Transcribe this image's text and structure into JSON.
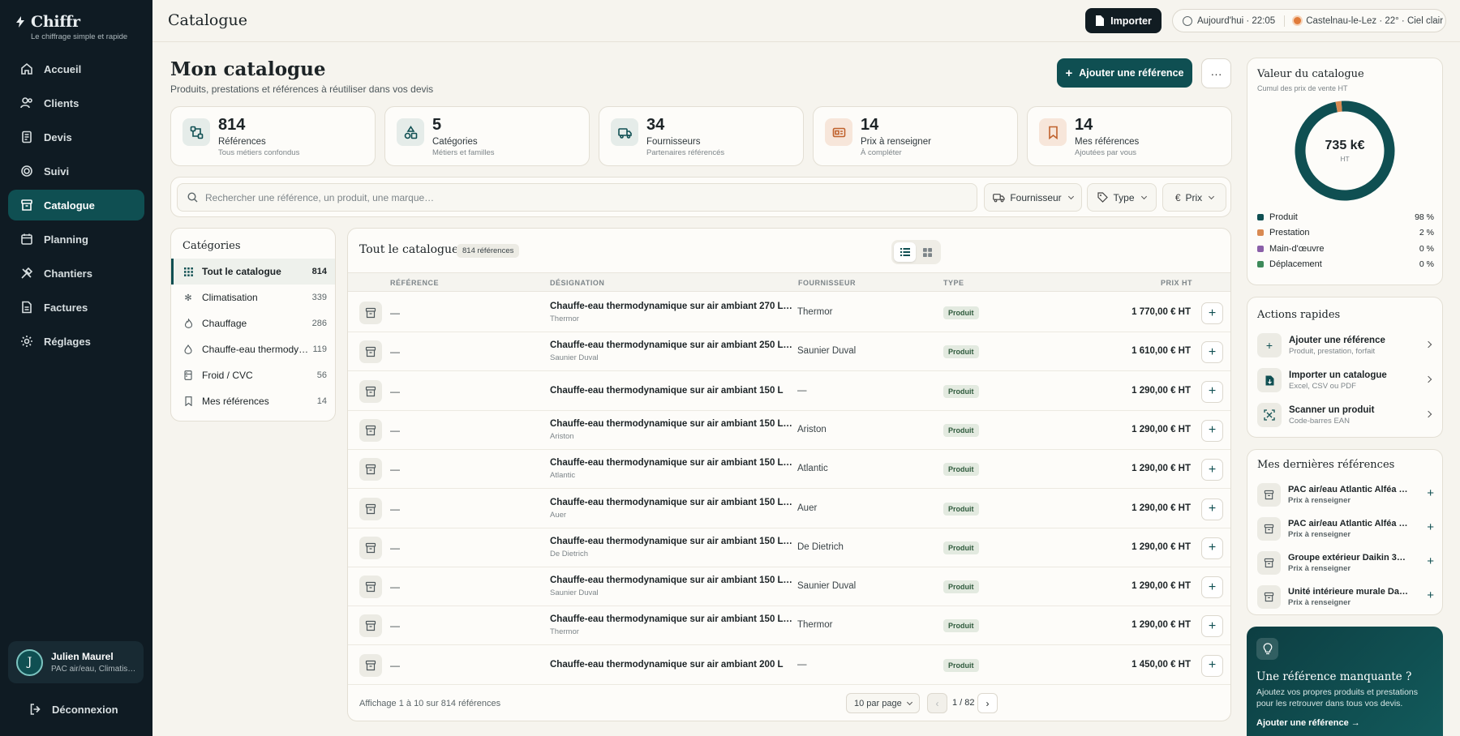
{
  "app": {
    "name": "Chiffr",
    "tagline": "Le chiffrage simple et rapide"
  },
  "nav": [
    {
      "label": "Accueil",
      "icon": "home-icon"
    },
    {
      "label": "Clients",
      "icon": "users-icon"
    },
    {
      "label": "Devis",
      "icon": "document-icon"
    },
    {
      "label": "Suivi",
      "icon": "target-icon"
    },
    {
      "label": "Catalogue",
      "icon": "archive-icon",
      "active": true
    },
    {
      "label": "Planning",
      "icon": "calendar-icon"
    },
    {
      "label": "Chantiers",
      "icon": "tools-icon"
    },
    {
      "label": "Factures",
      "icon": "invoice-icon"
    },
    {
      "label": "Réglages",
      "icon": "gear-icon"
    }
  ],
  "user": {
    "initial": "J",
    "name": "Julien Maurel",
    "sub": "PAC air/eau, Climatis…"
  },
  "logout_label": "Déconnexion",
  "topbar": {
    "title": "Catalogue",
    "import_label": "Importer",
    "time": "Aujourd'hui · 22:05",
    "weather": "Castelnau-le-Lez · 22° · Ciel clair"
  },
  "page": {
    "title": "Mon catalogue",
    "subtitle": "Produits, prestations et références à réutiliser dans vos devis",
    "add_label": "Ajouter une référence",
    "more_label": "···"
  },
  "stats": [
    {
      "value": "814",
      "label": "Références",
      "sub": "Tous métiers confondus",
      "color": "#0f4f52",
      "bg": "#e5ece9",
      "icon": "network-icon"
    },
    {
      "value": "5",
      "label": "Catégories",
      "sub": "Métiers et familles",
      "color": "#0f4f52",
      "bg": "#e5ece9",
      "icon": "shapes-icon"
    },
    {
      "value": "34",
      "label": "Fournisseurs",
      "sub": "Partenaires référencés",
      "color": "#0f4f52",
      "bg": "#e5ece9",
      "icon": "truck-icon"
    },
    {
      "value": "14",
      "label": "Prix à renseigner",
      "sub": "À compléter",
      "color": "#c0622d",
      "bg": "#f7e6da",
      "icon": "price-tag-icon"
    },
    {
      "value": "14",
      "label": "Mes références",
      "sub": "Ajoutées par vous",
      "color": "#c0622d",
      "bg": "#f7e6da",
      "icon": "bookmark-icon"
    }
  ],
  "search": {
    "placeholder": "Rechercher une référence, un produit, une marque…",
    "filters": [
      "Fournisseur",
      "Type",
      "Prix"
    ]
  },
  "categories": {
    "title": "Catégories",
    "items": [
      {
        "label": "Tout le catalogue",
        "count": "814",
        "icon": "grid-icon",
        "active": true
      },
      {
        "label": "Climatisation",
        "count": "339",
        "icon": "snowflake-icon"
      },
      {
        "label": "Chauffage",
        "count": "286",
        "icon": "flame-icon"
      },
      {
        "label": "Chauffe-eau thermody…",
        "count": "119",
        "icon": "droplet-icon"
      },
      {
        "label": "Froid / CVC",
        "count": "56",
        "icon": "fridge-icon"
      },
      {
        "label": "Mes références",
        "count": "14",
        "icon": "bookmark-icon"
      }
    ]
  },
  "table": {
    "title": "Tout le catalogue",
    "badge": "814 références",
    "columns": {
      "ref": "RÉFÉRENCE",
      "name": "DÉSIGNATION",
      "supplier": "FOURNISSEUR",
      "type": "TYPE",
      "price": "PRIX HT"
    },
    "rows": [
      {
        "ref": "—",
        "name": "Chauffe-eau thermodynamique sur air ambiant 270 L T…",
        "sub": "Thermor",
        "supplier": "Thermor",
        "type": "Produit",
        "price": "1 770,00 € HT"
      },
      {
        "ref": "—",
        "name": "Chauffe-eau thermodynamique sur air ambiant 250 L S…",
        "sub": "Saunier Duval",
        "supplier": "Saunier Duval",
        "type": "Produit",
        "price": "1 610,00 € HT"
      },
      {
        "ref": "—",
        "name": "Chauffe-eau thermodynamique sur air ambiant 150 L",
        "sub": "",
        "supplier": "—",
        "type": "Produit",
        "price": "1 290,00 € HT"
      },
      {
        "ref": "—",
        "name": "Chauffe-eau thermodynamique sur air ambiant 150 L A…",
        "sub": "Ariston",
        "supplier": "Ariston",
        "type": "Produit",
        "price": "1 290,00 € HT"
      },
      {
        "ref": "—",
        "name": "Chauffe-eau thermodynamique sur air ambiant 150 L A…",
        "sub": "Atlantic",
        "supplier": "Atlantic",
        "type": "Produit",
        "price": "1 290,00 € HT"
      },
      {
        "ref": "—",
        "name": "Chauffe-eau thermodynamique sur air ambiant 150 L A…",
        "sub": "Auer",
        "supplier": "Auer",
        "type": "Produit",
        "price": "1 290,00 € HT"
      },
      {
        "ref": "—",
        "name": "Chauffe-eau thermodynamique sur air ambiant 150 L D…",
        "sub": "De Dietrich",
        "supplier": "De Dietrich",
        "type": "Produit",
        "price": "1 290,00 € HT"
      },
      {
        "ref": "—",
        "name": "Chauffe-eau thermodynamique sur air ambiant 150 L S…",
        "sub": "Saunier Duval",
        "supplier": "Saunier Duval",
        "type": "Produit",
        "price": "1 290,00 € HT"
      },
      {
        "ref": "—",
        "name": "Chauffe-eau thermodynamique sur air ambiant 150 L T…",
        "sub": "Thermor",
        "supplier": "Thermor",
        "type": "Produit",
        "price": "1 290,00 € HT"
      },
      {
        "ref": "—",
        "name": "Chauffe-eau thermodynamique sur air ambiant 200 L",
        "sub": "",
        "supplier": "—",
        "type": "Produit",
        "price": "1 450,00 € HT"
      }
    ],
    "footer": "Affichage 1 à 10 sur 814 références",
    "per_page": "10 par page",
    "page": "1 / 82"
  },
  "value_card": {
    "title": "Valeur du catalogue",
    "sub": "Cumul des prix de vente HT",
    "total": "735 k€",
    "unit": "HT",
    "segments": [
      {
        "label": "Produit",
        "pct": "98 %",
        "value": 98,
        "color": "#0f4f52"
      },
      {
        "label": "Prestation",
        "pct": "2 %",
        "value": 2,
        "color": "#d98a52"
      },
      {
        "label": "Main-d'œuvre",
        "pct": "0 %",
        "value": 0,
        "color": "#8a5fa8"
      },
      {
        "label": "Déplacement",
        "pct": "0 %",
        "value": 0,
        "color": "#3d8a5a"
      }
    ]
  },
  "quick_actions": {
    "title": "Actions rapides",
    "items": [
      {
        "title": "Ajouter une référence",
        "sub": "Produit, prestation, forfait",
        "icon": "plus-icon"
      },
      {
        "title": "Importer un catalogue",
        "sub": "Excel, CSV ou PDF",
        "icon": "file-import-icon"
      },
      {
        "title": "Scanner un produit",
        "sub": "Code-barres EAN",
        "icon": "scan-icon"
      }
    ]
  },
  "latest": {
    "title": "Mes dernières références",
    "items": [
      {
        "title": "PAC air/eau Atlantic Alféa Ext…",
        "sub": "Prix à renseigner"
      },
      {
        "title": "PAC air/eau Atlantic Alféa Ext…",
        "sub": "Prix à renseigner"
      },
      {
        "title": "Groupe extérieur Daikin 3MX…",
        "sub": "Prix à renseigner"
      },
      {
        "title": "Unité intérieure murale Daikin…",
        "sub": "Prix à renseigner"
      }
    ]
  },
  "promo": {
    "title": "Une référence manquante ?",
    "text": "Ajoutez vos propres produits et prestations pour les retrouver dans tous vos devis.",
    "link": "Ajouter une référence →"
  }
}
